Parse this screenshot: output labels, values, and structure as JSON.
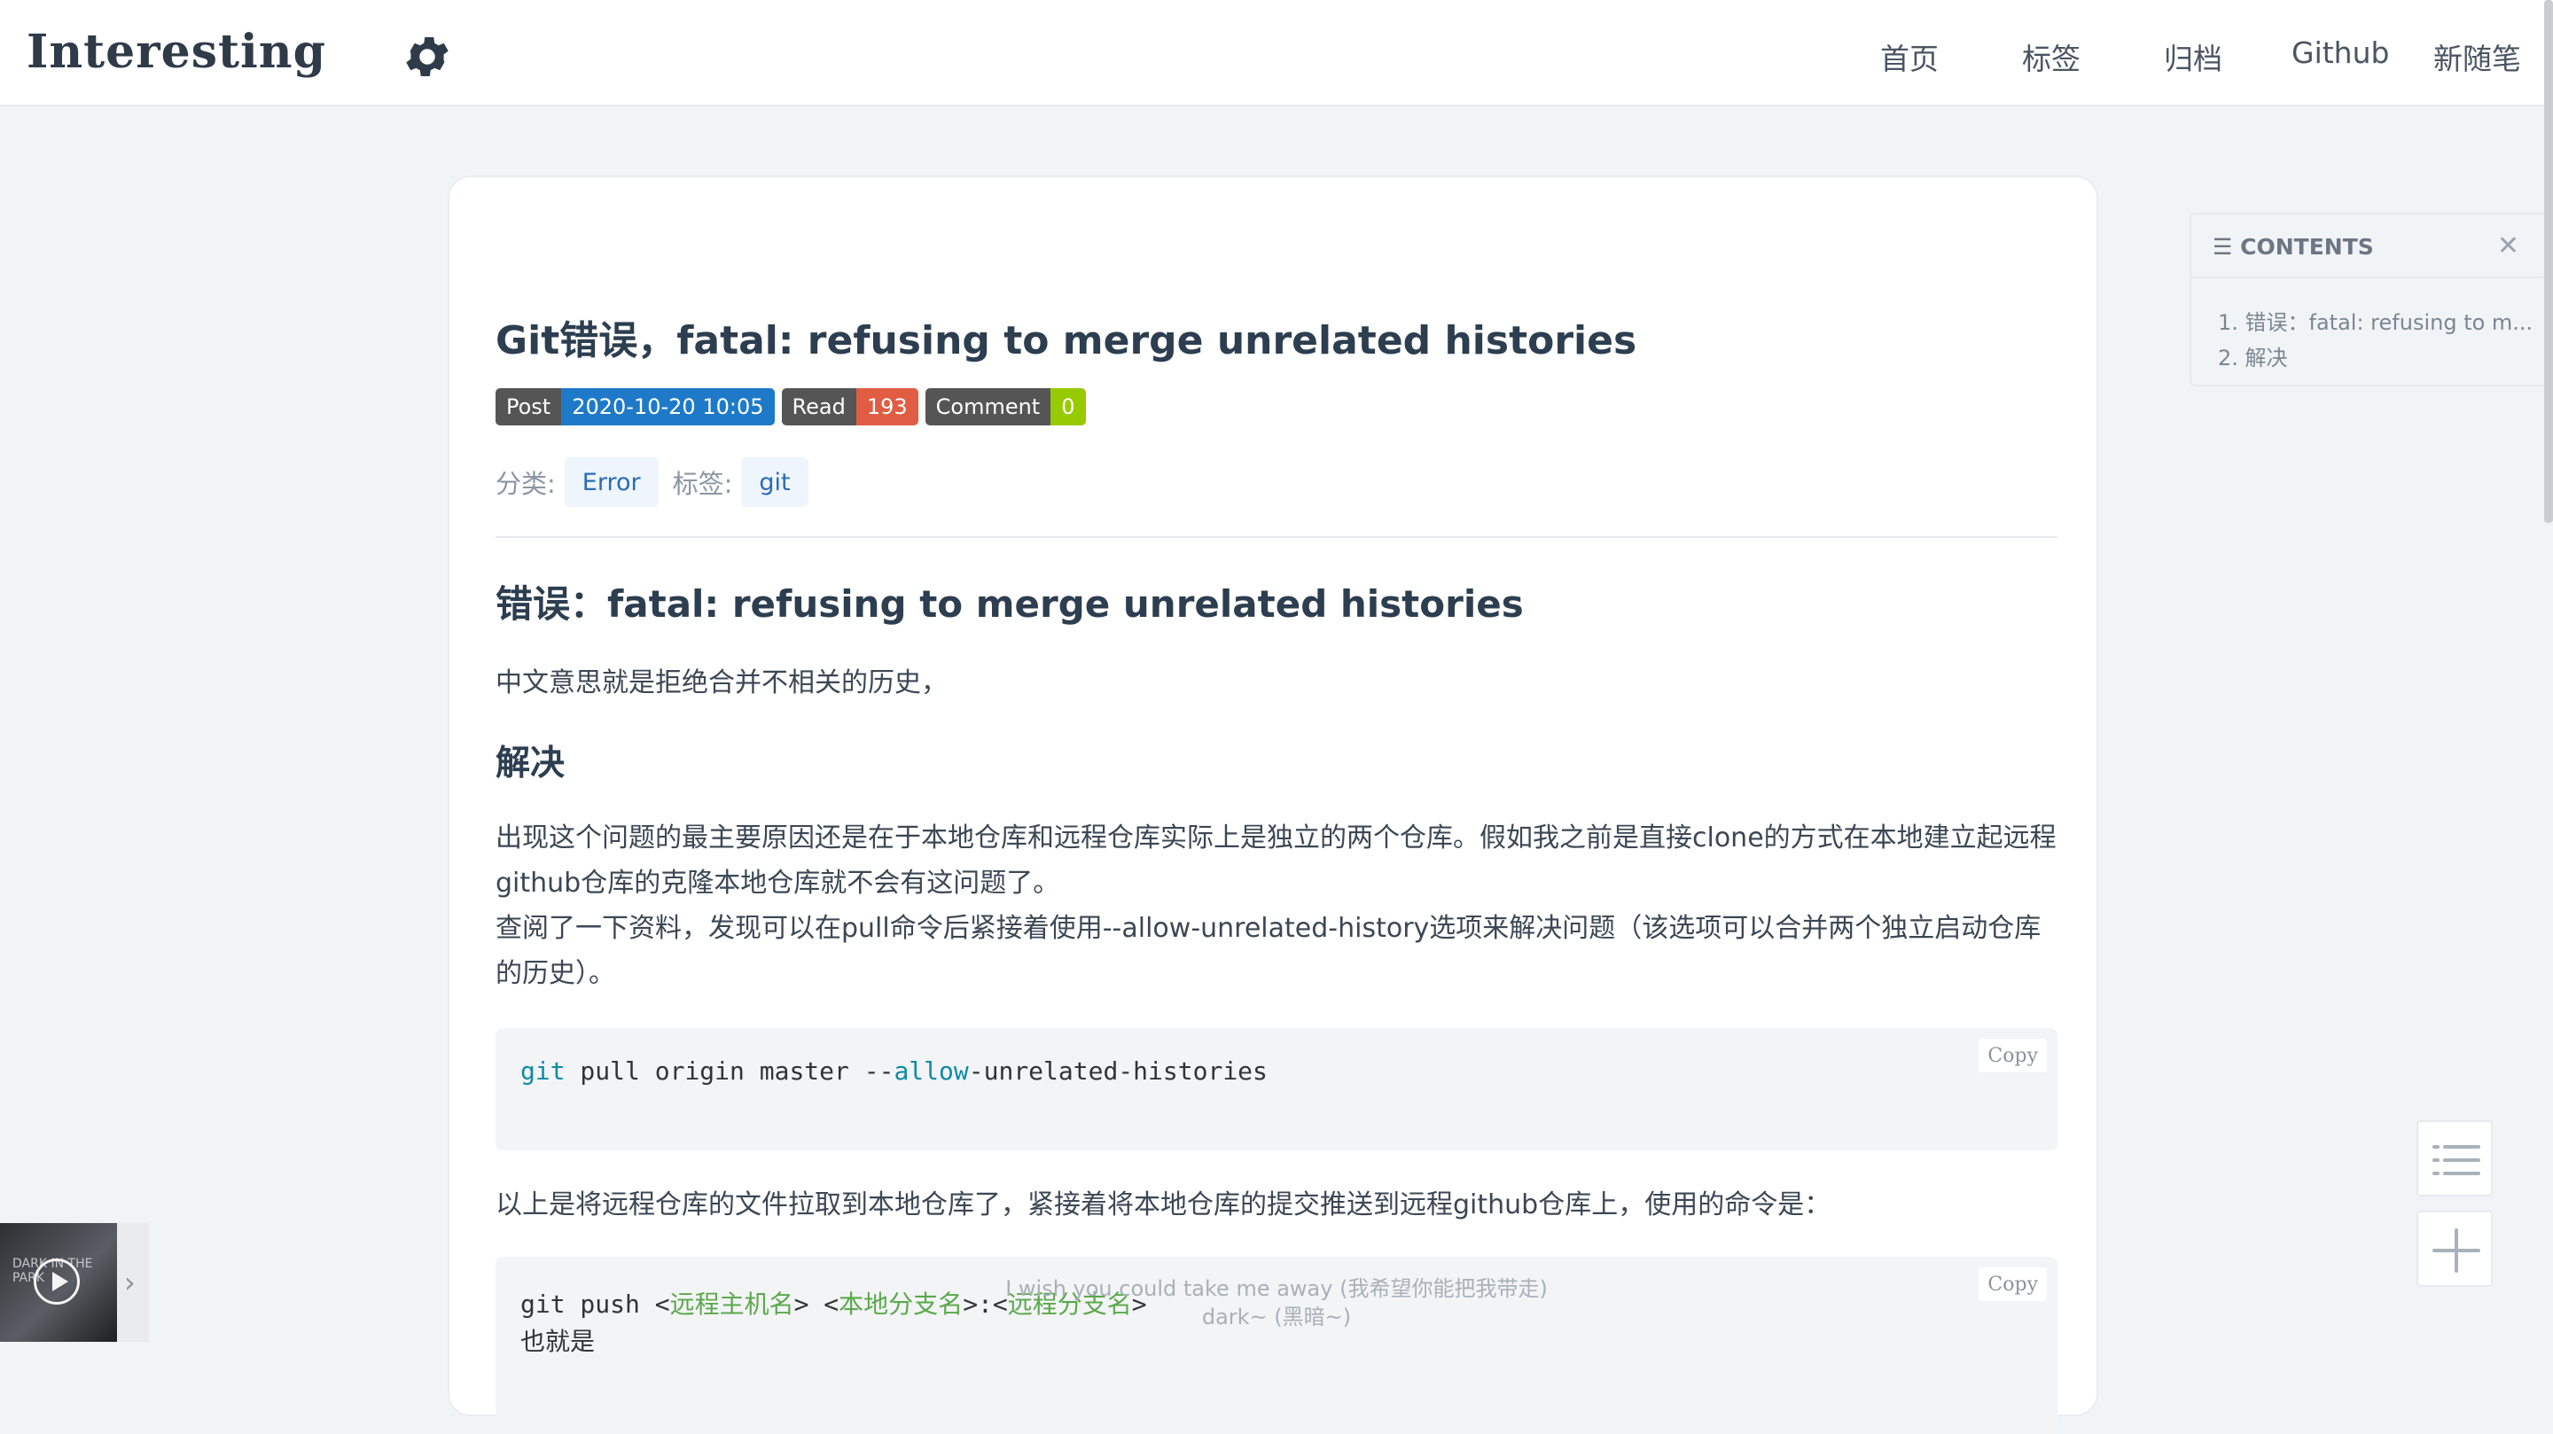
{
  "header": {
    "brand": "Interesting",
    "settings_icon": "gear-icon",
    "nav": [
      "首页",
      "标签",
      "归档",
      "Github",
      "新随笔"
    ]
  },
  "post": {
    "title": "Git错误，fatal: refusing to merge unrelated histories",
    "badges": {
      "post_key": "Post",
      "post_val": "2020-10-20 10:05",
      "read_key": "Read",
      "read_val": "193",
      "comment_key": "Comment",
      "comment_val": "0"
    },
    "category_label": "分类:",
    "category": "Error",
    "tags_label": "标签:",
    "tag": "git",
    "h2": "错误：fatal: refusing to merge unrelated histories",
    "p1": "中文意思就是拒绝合并不相关的历史，",
    "h3": "解决",
    "para1": "出现这个问题的最主要原因还是在于本地仓库和远程仓库实际上是独立的两个仓库。假如我之前是直接clone的方式在本地建立起远程github仓库的克隆本地仓库就不会有这问题了。",
    "para2": "查阅了一下资料，发现可以在pull命令后紧接着使用--allow-unrelated-history选项来解决问题（该选项可以合并两个独立启动仓库的历史）。",
    "code1": {
      "a": "git",
      "b": " pull origin master --",
      "c": "allow",
      "d": "-unrelated-histories"
    },
    "para3": "以上是将远程仓库的文件拉取到本地仓库了，紧接着将本地仓库的提交推送到远程github仓库上，使用的命令是：",
    "code2": {
      "a": "git push <",
      "b": "远程主机名",
      "c": "> <",
      "d": "本地分支名",
      "e": ">:<",
      "f": "远程分支名",
      "g": ">",
      "line2": "也就是"
    },
    "copy_label": "Copy"
  },
  "toc": {
    "title": "CONTENTS",
    "items": [
      "1. 错误：fatal: refusing to m...",
      "2. 解决"
    ]
  },
  "player": {
    "cover_text": "DARK IN THE PARK",
    "lyric1": "I wish you could take me away (我希望你能把我带走)",
    "lyric2": "dark~ (黑暗~)"
  },
  "colors": {
    "post": "#1e7ac8",
    "read": "#e05d44",
    "comment": "#97ca00",
    "tag_bg": "#eef5fc"
  }
}
